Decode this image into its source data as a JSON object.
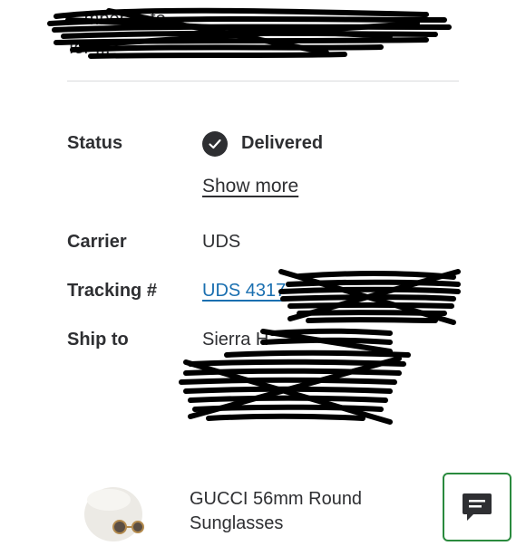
{
  "header": {
    "top_text": "...mber ... to ...",
    "sub_text": "for ..."
  },
  "order": {
    "status_label": "Status",
    "status_value": "Delivered",
    "show_more_label": "Show more",
    "carrier_label": "Carrier",
    "carrier_value": "UDS",
    "tracking_label": "Tracking #",
    "tracking_value": "UDS 4317",
    "ship_to_label": "Ship to",
    "ship_to_value": "Sierra H"
  },
  "product": {
    "name": "GUCCI 56mm Round Sunglasses"
  },
  "icons": {
    "status": "check-circle-icon",
    "chat": "chat-icon"
  },
  "colors": {
    "text": "#2e2f32",
    "link": "#1a6fb0",
    "chat_border": "#2a8a3e"
  }
}
